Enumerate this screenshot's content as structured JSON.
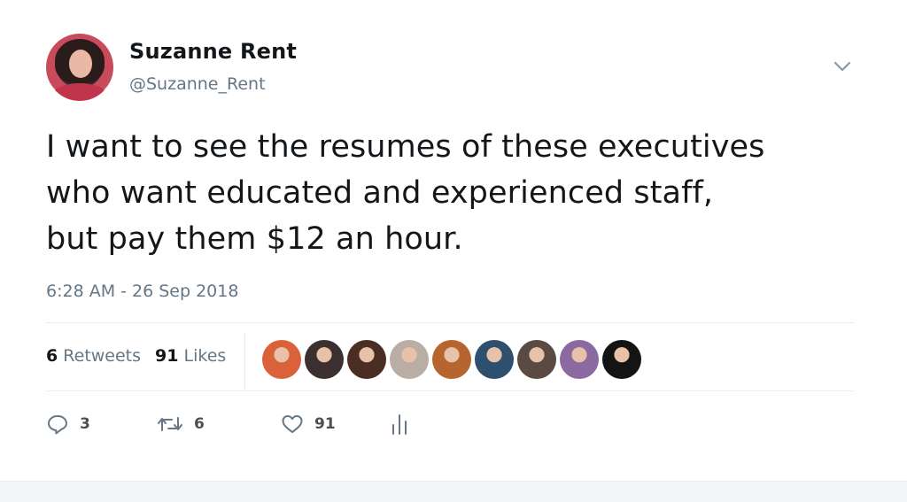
{
  "author": {
    "name": "Suzanne Rent",
    "handle": "@Suzanne_Rent"
  },
  "tweet": {
    "lines": [
      "I want to see the resumes of these executives",
      "who want educated and experienced staff,",
      "but pay them $12 an hour."
    ],
    "timestamp": "6:28 AM - 26 Sep 2018"
  },
  "stats": {
    "retweets_count": "6",
    "retweets_label": "Retweets",
    "likes_count": "91",
    "likes_label": "Likes"
  },
  "likers": [
    {
      "icon": "avatar-glasses-mustache",
      "color": "#d9623b"
    },
    {
      "icon": "avatar-dark-hair",
      "color": "#3b2f2f"
    },
    {
      "icon": "avatar-woman-dark",
      "color": "#4a2e24"
    },
    {
      "icon": "avatar-dog",
      "color": "#b9ada4"
    },
    {
      "icon": "avatar-red-hair",
      "color": "#b5652d"
    },
    {
      "icon": "avatar-landscape",
      "color": "#2f4f6f"
    },
    {
      "icon": "avatar-woman-glasses",
      "color": "#5a4a42"
    },
    {
      "icon": "avatar-colorful",
      "color": "#8a6aa0"
    },
    {
      "icon": "avatar-logo-black",
      "color": "#141414"
    }
  ],
  "actions": {
    "reply_count": "3",
    "retweet_count": "6",
    "like_count": "91"
  },
  "colors": {
    "text": "#14171a",
    "secondary": "#657786",
    "divider": "#e6ecf0"
  }
}
